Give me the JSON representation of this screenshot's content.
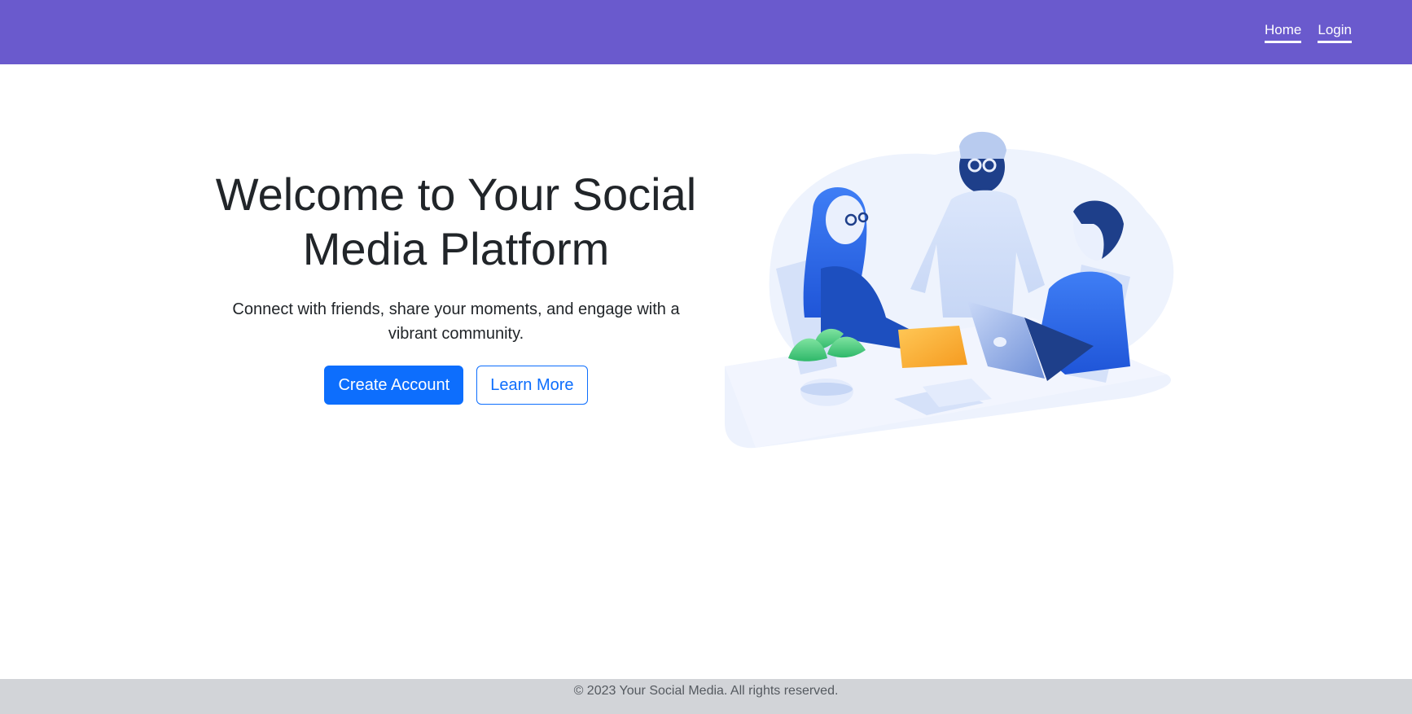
{
  "nav": {
    "links": [
      {
        "label": "Home"
      },
      {
        "label": "Login"
      }
    ]
  },
  "hero": {
    "title": "Welcome to Your Social Media Platform",
    "subtitle": "Connect with friends, share your moments, and engage with a vibrant community.",
    "primary_button": "Create Account",
    "secondary_button": "Learn More",
    "illustration_icon": "team-meeting-illustration"
  },
  "footer": {
    "text": "© 2023 Your Social Media. All rights reserved."
  },
  "colors": {
    "navbar": "#6a5acd",
    "primary": "#0d6efd",
    "footer": "#d2d4d8"
  }
}
